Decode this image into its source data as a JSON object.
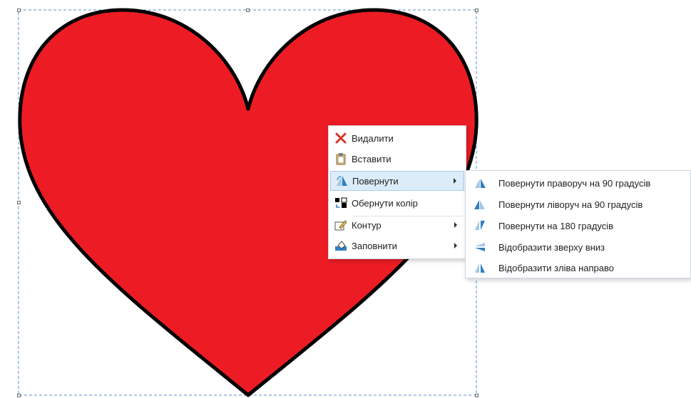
{
  "context_menu": {
    "items": [
      {
        "label": "Видалити",
        "icon": "delete-x-icon",
        "has_submenu": false
      },
      {
        "label": "Вставити",
        "icon": "paste-icon",
        "has_submenu": false
      },
      {
        "label": "Повернути",
        "icon": "rotate-icon",
        "has_submenu": true,
        "active": true
      },
      {
        "label": "Обернути колір",
        "icon": "invert-color-icon",
        "has_submenu": false
      },
      {
        "label": "Контур",
        "icon": "outline-pencil-icon",
        "has_submenu": true
      },
      {
        "label": "Заповнити",
        "icon": "fill-bucket-icon",
        "has_submenu": true
      }
    ]
  },
  "rotate_submenu": {
    "items": [
      {
        "label": "Повернути праворуч на 90 градусів",
        "icon": "rotate-right-90-icon"
      },
      {
        "label": "Повернути ліворуч на 90 градусів",
        "icon": "rotate-left-90-icon"
      },
      {
        "label": "Повернути на 180 градусів",
        "icon": "rotate-180-icon"
      },
      {
        "label": "Відобразити зверху вниз",
        "icon": "flip-vertical-icon"
      },
      {
        "label": "Відобразити зліва направо",
        "icon": "flip-horizontal-icon"
      }
    ]
  },
  "shape": {
    "type": "heart",
    "fill_color": "#ed1c24",
    "outline_color": "#000000",
    "selected": true
  },
  "colors": {
    "menu_highlight": "#dcecf9",
    "menu_highlight_border": "#a9cdea",
    "selection_dash": "#5b8fc9"
  }
}
